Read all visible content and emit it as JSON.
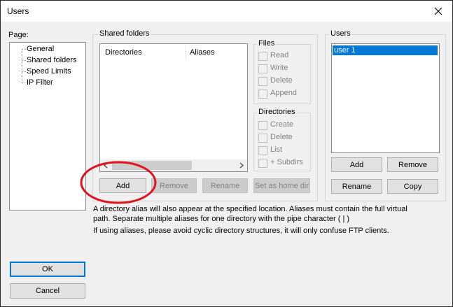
{
  "window": {
    "title": "Users"
  },
  "page_label": "Page:",
  "pages": [
    "General",
    "Shared folders",
    "Speed Limits",
    "IP Filter"
  ],
  "shared": {
    "group_title": "Shared folders",
    "columns": {
      "directories": "Directories",
      "aliases": "Aliases"
    },
    "add": "Add",
    "remove": "Remove",
    "rename": "Rename",
    "set_home": "Set as home dir"
  },
  "files": {
    "title": "Files",
    "options": [
      "Read",
      "Write",
      "Delete",
      "Append"
    ]
  },
  "directories": {
    "title": "Directories",
    "options": [
      "Create",
      "Delete",
      "List",
      "+ Subdirs"
    ]
  },
  "users": {
    "title": "Users",
    "list": [
      "user 1"
    ],
    "add": "Add",
    "remove": "Remove",
    "rename": "Rename",
    "copy": "Copy"
  },
  "notes": {
    "line1": "A directory alias will also appear at the specified location. Aliases must contain the full virtual",
    "line2": "path. Separate multiple aliases for one directory with the pipe character ( | )",
    "line3": "If using aliases, please avoid cyclic directory structures, it will only confuse FTP clients."
  },
  "ok": "OK",
  "cancel": "Cancel",
  "colors": {
    "selection": "#0078d7",
    "annotation": "#e0141e"
  }
}
